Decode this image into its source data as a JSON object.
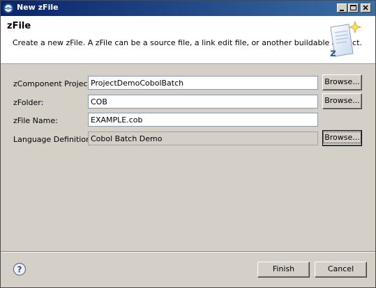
{
  "window": {
    "title": "New zFile"
  },
  "header": {
    "title": "zFile",
    "description": "Create a new zFile.  A zFile can be a source file, a link edit file, or another buildable artifact."
  },
  "form": {
    "project": {
      "label": "zComponent Project:",
      "value": "ProjectDemoCobolBatch",
      "button": "Browse..."
    },
    "folder": {
      "label": "zFolder:",
      "value": "COB",
      "button": "Browse..."
    },
    "file_name": {
      "label": "zFile Name:",
      "value": "EXAMPLE.cob"
    },
    "language": {
      "label": "Language Definition:",
      "value": "Cobol Batch Demo",
      "button": "Browse..."
    }
  },
  "footer": {
    "finish_label": "Finish",
    "cancel_label": "Cancel"
  },
  "icons": {
    "app": "eclipse-icon",
    "help": "help-icon",
    "banner": "new-zfile-wizard-icon"
  }
}
